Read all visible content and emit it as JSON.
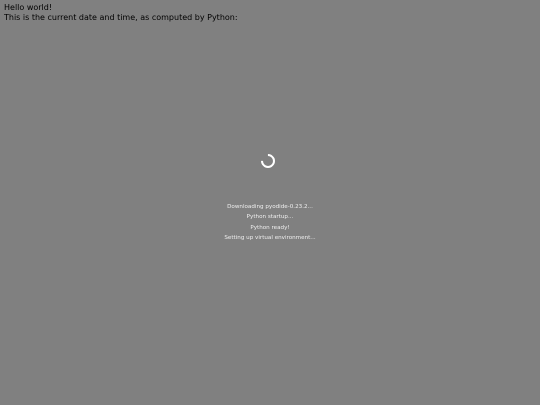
{
  "content": {
    "line1": "Hello world!",
    "line2": "This is the current date and time, as computed by Python:"
  },
  "loader": {
    "icon": "spinner-icon",
    "messages": [
      "Downloading pyodide-0.23.2...",
      "Python startup...",
      "Python ready!",
      "Setting up virtual environment..."
    ]
  },
  "colors": {
    "background": "#808080",
    "text": "#000000",
    "loader_text": "#f0f0f0",
    "spinner": "#ffffff"
  }
}
